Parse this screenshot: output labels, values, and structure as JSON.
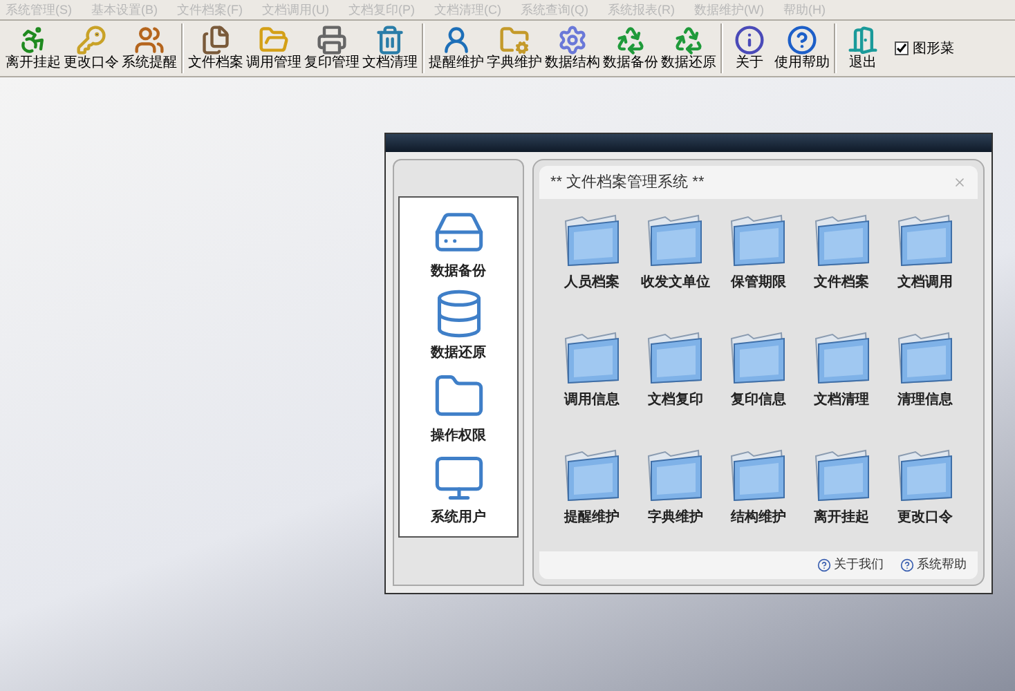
{
  "menu_bar": [
    "系统管理(S)",
    "基本设置(B)",
    "文件档案(F)",
    "文档调用(U)",
    "文档复印(P)",
    "文档清理(C)",
    "系统查询(Q)",
    "系统报表(R)",
    "数据维护(W)",
    "帮助(H)"
  ],
  "toolbar": [
    {
      "buttons": [
        "离开挂起",
        "更改口令",
        "系统提醒"
      ]
    },
    {
      "buttons": [
        "文件档案",
        "调用管理",
        "复印管理",
        "文档清理"
      ]
    },
    {
      "buttons": [
        "提醒维护",
        "字典维护",
        "数据结构",
        "数据备份",
        "数据还原"
      ]
    },
    {
      "buttons": [
        "关于",
        "使用帮助"
      ]
    },
    {
      "buttons": [
        "退出"
      ]
    }
  ],
  "graphic_menu_checkbox": {
    "label": "图形菜",
    "checked": true
  },
  "side_panel": {
    "items": [
      "数据备份",
      "数据还原",
      "操作权限",
      "系统用户"
    ]
  },
  "main_panel": {
    "title": "** 文件档案管理系统 **",
    "items": [
      "人员档案",
      "收发文单位",
      "保管期限",
      "文件档案",
      "文档调用",
      "调用信息",
      "文档复印",
      "复印信息",
      "文档清理",
      "清理信息",
      "提醒维护",
      "字典维护",
      "结构维护",
      "离开挂起",
      "更改口令"
    ],
    "footer_links": [
      "关于我们",
      "系统帮助"
    ]
  }
}
